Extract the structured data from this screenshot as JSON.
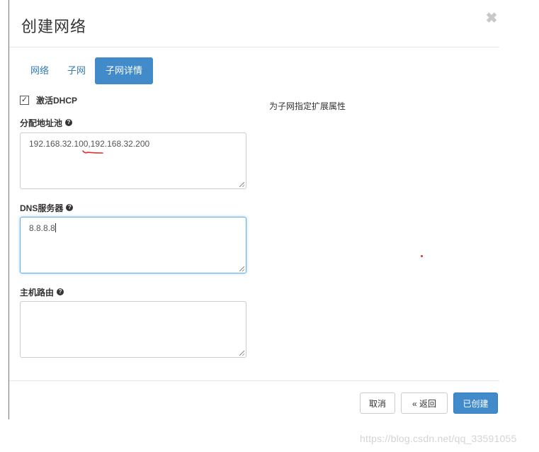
{
  "modal": {
    "title": "创建网络",
    "close_glyph": "✖"
  },
  "tabs": [
    {
      "label": "网络",
      "active": false
    },
    {
      "label": "子网",
      "active": false
    },
    {
      "label": "子网详情",
      "active": true
    }
  ],
  "form": {
    "enable_dhcp": {
      "label": "激活DHCP",
      "checked": true
    },
    "allocation_pools": {
      "label": "分配地址池",
      "value": "192.168.32.100,192.168.32.200"
    },
    "dns_servers": {
      "label": "DNS服务器",
      "value": "8.8.8.8"
    },
    "host_routes": {
      "label": "主机路由",
      "value": ""
    }
  },
  "help": {
    "description": "为子网指定扩展属性"
  },
  "footer": {
    "cancel_label": "取消",
    "back_label": "« 返回",
    "create_label": "已创建"
  },
  "watermark": "https://blog.csdn.net/qq_33591055",
  "colors": {
    "primary": "#428bca",
    "link": "#337ab7",
    "focus": "#66afe9",
    "annotation": "#e03030"
  }
}
